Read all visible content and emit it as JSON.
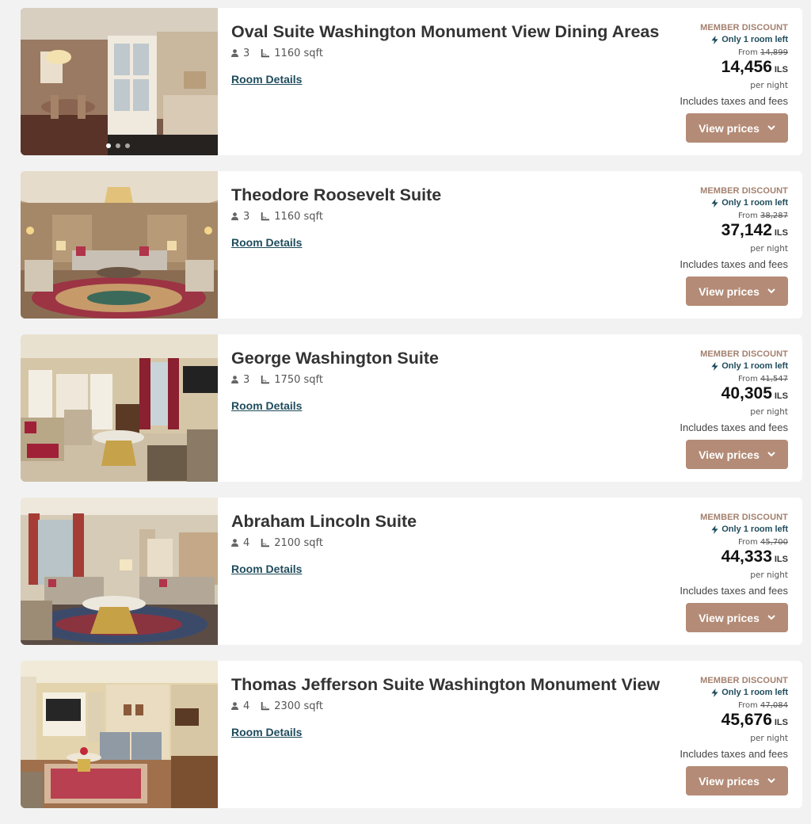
{
  "labels": {
    "room_details": "Room Details",
    "member_discount": "MEMBER DISCOUNT",
    "only_left": "Only 1 room left",
    "from": "From",
    "currency": "ILS",
    "per_night": "per night",
    "taxes": "Includes taxes and fees",
    "view_prices": "View prices"
  },
  "icons": {
    "guests": "person-icon",
    "size": "floor-plan-icon",
    "alert": "lightning-icon",
    "chevron": "chevron-down-icon"
  },
  "colors": {
    "button": "#b48b76",
    "member_discount": "#a4806e",
    "link": "#1f4c5c"
  },
  "rooms": [
    {
      "name": "Oval Suite Washington Monument View Dining Areas",
      "guests": "3",
      "size": "1160 sqft",
      "old_price": "14,899",
      "price": "14,456",
      "photo_dots": 3,
      "active_dot": 1
    },
    {
      "name": "Theodore Roosevelt Suite",
      "guests": "3",
      "size": "1160 sqft",
      "old_price": "38,287",
      "price": "37,142"
    },
    {
      "name": "George Washington Suite",
      "guests": "3",
      "size": "1750 sqft",
      "old_price": "41,547",
      "price": "40,305"
    },
    {
      "name": "Abraham Lincoln Suite",
      "guests": "4",
      "size": "2100 sqft",
      "old_price": "45,700",
      "price": "44,333"
    },
    {
      "name": "Thomas Jefferson Suite Washington Monument View",
      "guests": "4",
      "size": "2300 sqft",
      "old_price": "47,084",
      "price": "45,676"
    }
  ]
}
